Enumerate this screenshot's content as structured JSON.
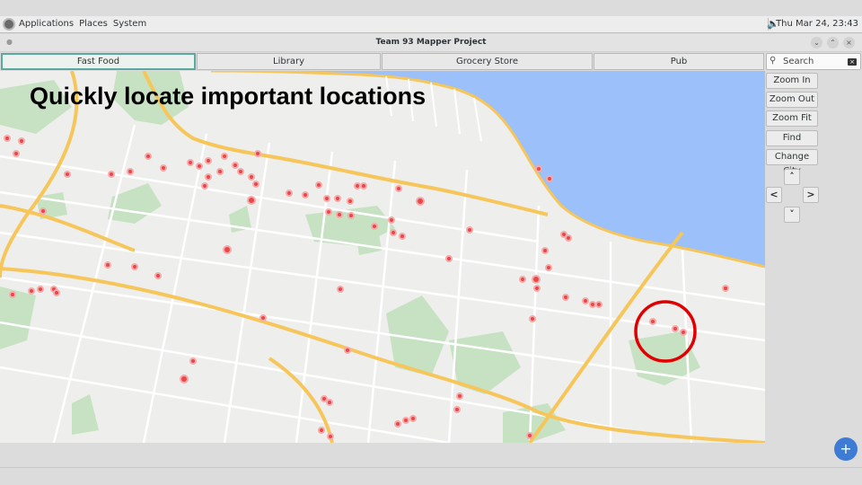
{
  "top_panel": {
    "menus": [
      "Applications",
      "Places",
      "System"
    ],
    "clock": "Thu Mar 24, 23:43"
  },
  "window": {
    "title": "Team 93 Mapper Project"
  },
  "tabs": [
    {
      "label": "Fast Food",
      "active": true
    },
    {
      "label": "Library",
      "active": false
    },
    {
      "label": "Grocery Store",
      "active": false
    },
    {
      "label": "Pub",
      "active": false
    }
  ],
  "search": {
    "placeholder": "Search"
  },
  "side_buttons": [
    "Zoom In",
    "Zoom Out",
    "Zoom Fit",
    "Find",
    "Change City"
  ],
  "map": {
    "headline": "Quickly locate important locations",
    "colors": {
      "water": "#9cc0f9",
      "land": "#eeeeec",
      "park": "#c6e2c3",
      "road": "#ffffff",
      "highway": "#f6c65a",
      "poi": "#e8484a",
      "highlight": "#e00000"
    }
  },
  "icons": {
    "search": "search-icon",
    "clear": "clear-icon",
    "add": "plus-icon"
  }
}
